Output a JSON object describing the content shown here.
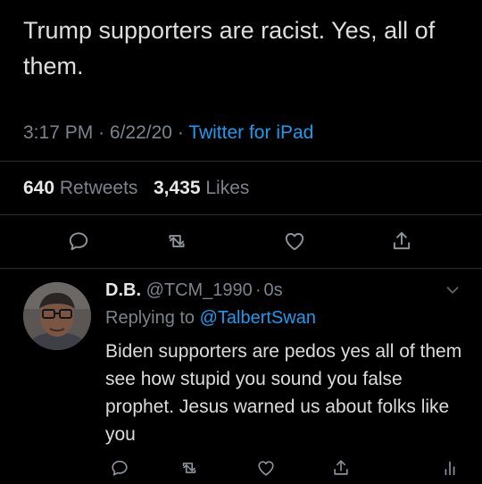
{
  "main_tweet": {
    "text": "Trump supporters are racist. Yes, all of them.",
    "time": "3:17 PM",
    "date": "6/22/20",
    "dot": "·",
    "source": "Twitter for iPad",
    "retweets_count": "640",
    "retweets_label": "Retweets",
    "likes_count": "3,435",
    "likes_label": "Likes"
  },
  "reply": {
    "display_name": "D.B.",
    "handle": "@TCM_1990",
    "dot": "·",
    "age": "0s",
    "replying_prefix": "Replying to",
    "replying_handle": "@TalbertSwan",
    "text": "Biden supporters are pedos yes all of them see how stupid you sound you false prophet. Jesus warned us about folks like you"
  },
  "icons": {
    "reply": "reply-icon",
    "retweet": "retweet-icon",
    "like": "heart-icon",
    "share": "share-icon",
    "analytics": "analytics-icon",
    "menu": "chevron-down-icon"
  },
  "colors": {
    "background": "#000000",
    "link": "#1d9bf0",
    "secondary": "#7b848c",
    "primary_text": "#e7e7e7",
    "icon": "#8b949b"
  }
}
